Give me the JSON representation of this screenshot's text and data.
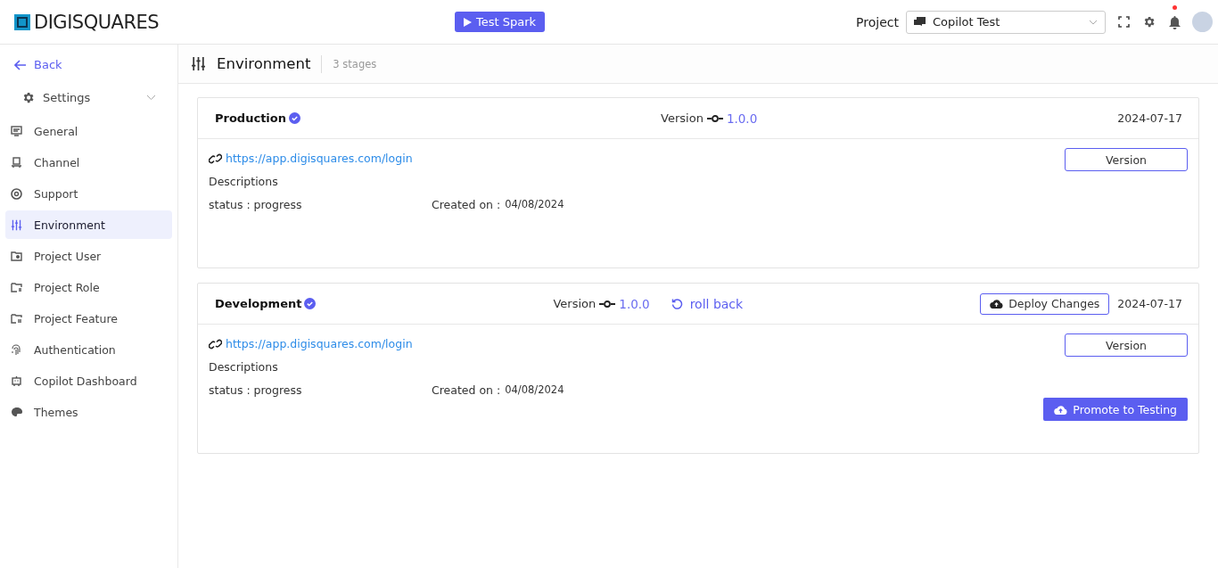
{
  "header": {
    "logo": "DIGISQUARES",
    "test_button": "Test Spark",
    "project_label": "Project",
    "project_select": "Copilot Test",
    "notifications": {
      "unread": true
    }
  },
  "sidebar": {
    "back": "Back",
    "settings": {
      "label": "Settings",
      "expanded": true
    },
    "items": [
      {
        "label": "General",
        "selected": false
      },
      {
        "label": "Channel",
        "selected": false
      },
      {
        "label": "Support",
        "selected": false
      },
      {
        "label": "Environment",
        "selected": true
      },
      {
        "label": "Project User",
        "selected": false
      },
      {
        "label": "Project Role",
        "selected": false
      },
      {
        "label": "Project Feature",
        "selected": false
      },
      {
        "label": "Authentication",
        "selected": false
      },
      {
        "label": "Copilot Dashboard",
        "selected": false
      },
      {
        "label": "Themes",
        "selected": false
      }
    ]
  },
  "page": {
    "title": "Environment",
    "count": "3 stages"
  },
  "environments": [
    {
      "name": "Production",
      "verified": true,
      "version_label": "Version",
      "version": "1.0.0",
      "date": "2024-07-17",
      "url": "https://app.digisquares.com/login",
      "description": "Descriptions",
      "status": "status : progress",
      "created_label": "Created on :",
      "created_date": "04/08/2024",
      "version_button": "Version"
    },
    {
      "name": "Development",
      "verified": true,
      "version_label": "Version",
      "version": "1.0.0",
      "rollback": "roll back",
      "deploy_button": "Deploy Changes",
      "date": "2024-07-17",
      "url": "https://app.digisquares.com/login",
      "description": "Descriptions",
      "status": "status : progress",
      "created_label": "Created on :",
      "created_date": "04/08/2024",
      "version_button": "Version",
      "promote_button": "Promote to Testing"
    }
  ]
}
